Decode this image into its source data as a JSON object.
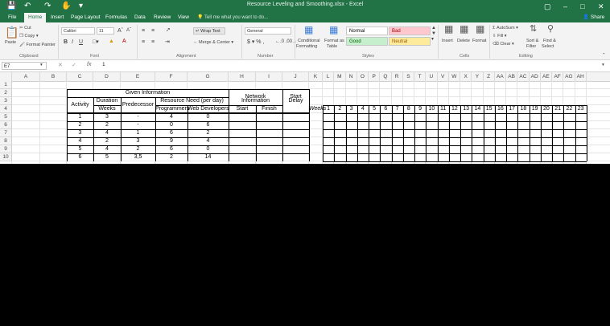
{
  "window": {
    "title": "Resource Leveling and Smoothing.xlsx - Excel",
    "quick_access": [
      "save",
      "undo",
      "redo",
      "touch-mode",
      "customize"
    ],
    "share_label": "Share",
    "tell_me": "Tell me what you want to do..."
  },
  "tabs": [
    "File",
    "Home",
    "Insert",
    "Page Layout",
    "Formulas",
    "Data",
    "Review",
    "View"
  ],
  "active_tab": "Home",
  "ribbon": {
    "clipboard": {
      "paste": "Paste",
      "cut": "Cut",
      "copy": "Copy",
      "format_painter": "Format Painter",
      "group": "Clipboard"
    },
    "font": {
      "name": "Calibri",
      "size": "11",
      "group": "Font"
    },
    "alignment": {
      "wrap": "Wrap Text",
      "merge": "Merge & Center",
      "group": "Alignment"
    },
    "number": {
      "format": "General",
      "group": "Number"
    },
    "styles": {
      "conditional": "Conditional",
      "conditional2": "Formatting",
      "format_as": "Format as",
      "table": "Table",
      "normal": "Normal",
      "bad": "Bad",
      "good": "Good",
      "neutral": "Neutral",
      "group": "Styles"
    },
    "cells": {
      "insert": "Insert",
      "delete": "Delete",
      "format": "Format",
      "group": "Cells"
    },
    "editing": {
      "autosum": "AutoSum",
      "fill": "Fill",
      "clear": "Clear",
      "sort": "Sort &",
      "filter": "Filter",
      "find": "Find &",
      "select": "Select",
      "group": "Editing"
    }
  },
  "formula_bar": {
    "name_box": "E7",
    "value": "1"
  },
  "columns": [
    "A",
    "B",
    "C",
    "D",
    "E",
    "F",
    "G",
    "H",
    "I",
    "J",
    "K",
    "L",
    "M",
    "N",
    "O",
    "P",
    "Q",
    "R",
    "S",
    "T",
    "U",
    "V",
    "W",
    "X",
    "Y",
    "Z",
    "AA",
    "AB",
    "AC",
    "AD",
    "AE",
    "AF",
    "AG",
    "AH"
  ],
  "rows": [
    "1",
    "2",
    "3",
    "4",
    "5",
    "6",
    "7",
    "8",
    "9",
    "10"
  ],
  "table": {
    "given_info": "Given Information",
    "duration": "Duration",
    "weeks": "Weeks",
    "activity": "Activity",
    "predecessor": "Predecessor",
    "resource_need": "Resource Need (per day)",
    "programmers": "Programmers",
    "web_devs": "Web Developers",
    "network_info": "Network",
    "network_info2": "Information",
    "start": "Start",
    "finish": "Finish",
    "start_delay": "Start",
    "start_delay2": "Delay",
    "weeks_label": "Weeks",
    "data": [
      [
        "1",
        "3",
        "-",
        "4",
        "0"
      ],
      [
        "2",
        "2",
        "-",
        "0",
        "6"
      ],
      [
        "3",
        "4",
        "1",
        "6",
        "2"
      ],
      [
        "4",
        "2",
        "3",
        "9",
        "4"
      ],
      [
        "5",
        "4",
        "2",
        "6",
        "0"
      ],
      [
        "6",
        "5",
        "3,5",
        "2",
        "14"
      ]
    ],
    "week_numbers": [
      "1",
      "2",
      "3",
      "4",
      "5",
      "6",
      "7",
      "8",
      "9",
      "10",
      "11",
      "12",
      "13",
      "14",
      "15",
      "16",
      "17",
      "18",
      "19",
      "20",
      "21",
      "22",
      "23"
    ]
  }
}
